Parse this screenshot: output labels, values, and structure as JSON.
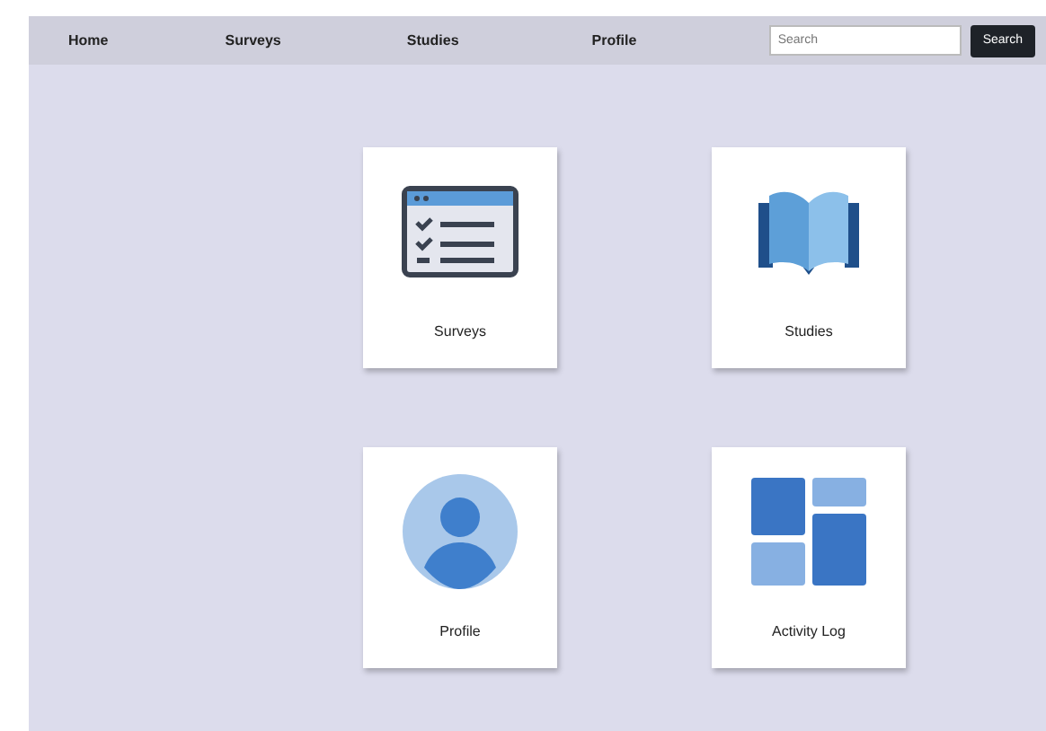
{
  "nav": {
    "items": [
      {
        "label": "Home"
      },
      {
        "label": "Surveys"
      },
      {
        "label": "Studies"
      },
      {
        "label": "Profile"
      }
    ],
    "search": {
      "placeholder": "Search"
    },
    "search_button": "Search"
  },
  "tiles": [
    {
      "kind": "survey",
      "label": "Surveys"
    },
    {
      "kind": "book",
      "label": "Studies"
    },
    {
      "kind": "person",
      "label": "Profile"
    },
    {
      "kind": "blocks",
      "label": "Activity Log"
    }
  ]
}
